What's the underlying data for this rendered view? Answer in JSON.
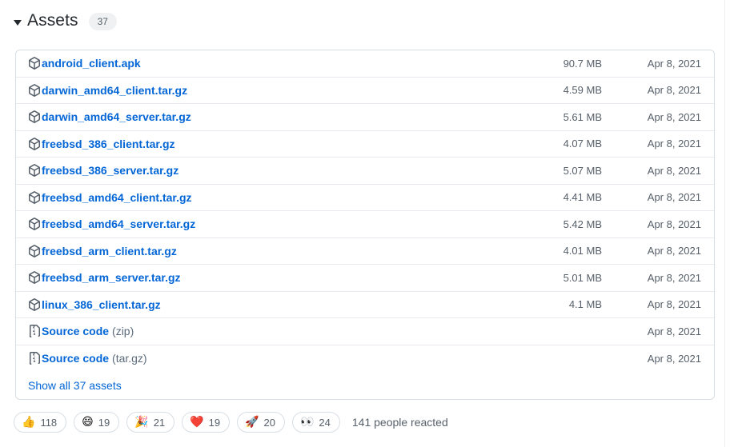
{
  "header": {
    "title": "Assets",
    "count": "37",
    "disclosure_icon": "triangle-down-icon"
  },
  "assets": {
    "columns": [
      "name",
      "size",
      "date"
    ],
    "rows": [
      {
        "icon": "package-icon",
        "name": "android_client.apk",
        "suffix": "",
        "size": "90.7 MB",
        "date": "Apr 8, 2021"
      },
      {
        "icon": "package-icon",
        "name": "darwin_amd64_client.tar.gz",
        "suffix": "",
        "size": "4.59 MB",
        "date": "Apr 8, 2021"
      },
      {
        "icon": "package-icon",
        "name": "darwin_amd64_server.tar.gz",
        "suffix": "",
        "size": "5.61 MB",
        "date": "Apr 8, 2021"
      },
      {
        "icon": "package-icon",
        "name": "freebsd_386_client.tar.gz",
        "suffix": "",
        "size": "4.07 MB",
        "date": "Apr 8, 2021"
      },
      {
        "icon": "package-icon",
        "name": "freebsd_386_server.tar.gz",
        "suffix": "",
        "size": "5.07 MB",
        "date": "Apr 8, 2021"
      },
      {
        "icon": "package-icon",
        "name": "freebsd_amd64_client.tar.gz",
        "suffix": "",
        "size": "4.41 MB",
        "date": "Apr 8, 2021"
      },
      {
        "icon": "package-icon",
        "name": "freebsd_amd64_server.tar.gz",
        "suffix": "",
        "size": "5.42 MB",
        "date": "Apr 8, 2021"
      },
      {
        "icon": "package-icon",
        "name": "freebsd_arm_client.tar.gz",
        "suffix": "",
        "size": "4.01 MB",
        "date": "Apr 8, 2021"
      },
      {
        "icon": "package-icon",
        "name": "freebsd_arm_server.tar.gz",
        "suffix": "",
        "size": "5.01 MB",
        "date": "Apr 8, 2021"
      },
      {
        "icon": "package-icon",
        "name": "linux_386_client.tar.gz",
        "suffix": "",
        "size": "4.1 MB",
        "date": "Apr 8, 2021"
      },
      {
        "icon": "file-zip-icon",
        "name": "Source code",
        "suffix": "(zip)",
        "size": "",
        "date": "Apr 8, 2021"
      },
      {
        "icon": "file-zip-icon",
        "name": "Source code",
        "suffix": "(tar.gz)",
        "size": "",
        "date": "Apr 8, 2021"
      }
    ],
    "show_all_label": "Show all 37 assets"
  },
  "reactions": {
    "items": [
      {
        "emoji": "👍",
        "name": "thumbs-up",
        "count": "118"
      },
      {
        "emoji": "😄",
        "name": "smile",
        "count": "19"
      },
      {
        "emoji": "🎉",
        "name": "tada",
        "count": "21"
      },
      {
        "emoji": "❤️",
        "name": "heart",
        "count": "19"
      },
      {
        "emoji": "🚀",
        "name": "rocket",
        "count": "20"
      },
      {
        "emoji": "👀",
        "name": "eyes",
        "count": "24"
      }
    ],
    "summary": "141 people reacted"
  },
  "colors": {
    "link": "#0366d6",
    "text": "#24292e",
    "muted": "#57606a",
    "border": "#d8dee4",
    "row_border": "#e6eaef",
    "badge_bg": "#eff1f3"
  }
}
